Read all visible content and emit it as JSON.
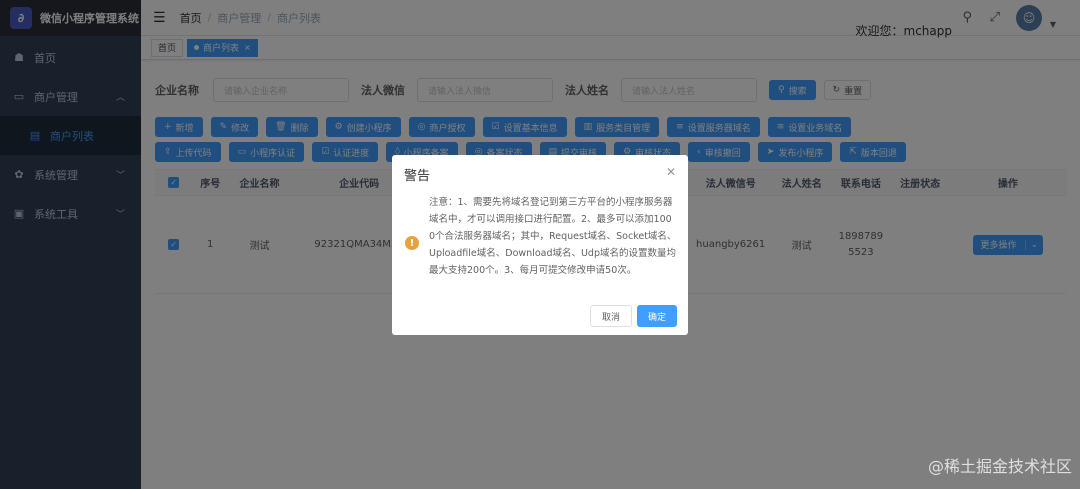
{
  "app": {
    "title": "微信小程序管理系统",
    "logo_glyph": "∂"
  },
  "sidebar": {
    "items": [
      {
        "label": "首页",
        "icon": "dashboard-icon"
      },
      {
        "label": "商户管理",
        "icon": "merchant-icon",
        "expanded": true
      },
      {
        "label": "商户列表",
        "icon": "list-icon",
        "active": true
      },
      {
        "label": "系统管理",
        "icon": "gear-icon"
      },
      {
        "label": "系统工具",
        "icon": "toolbox-icon"
      }
    ]
  },
  "navbar": {
    "breadcrumb": [
      "首页",
      "商户管理",
      "商户列表"
    ],
    "welcome": "欢迎您：mchapp"
  },
  "tags": [
    {
      "label": "首页",
      "active": false
    },
    {
      "label": "商户列表",
      "active": true
    }
  ],
  "search": {
    "fields": [
      {
        "label": "企业名称",
        "placeholder": "请输入企业名称"
      },
      {
        "label": "法人微信",
        "placeholder": "请输入法人微信"
      },
      {
        "label": "法人姓名",
        "placeholder": "请输入法人姓名"
      }
    ],
    "search_label": "搜索",
    "reset_label": "重置"
  },
  "toolbar_row1": [
    "新增",
    "修改",
    "删除",
    "创建小程序",
    "商户授权",
    "设置基本信息",
    "服务类目管理",
    "设置服务器域名",
    "设置业务域名"
  ],
  "toolbar_row2": [
    "上传代码",
    "小程序认证",
    "认证进度",
    "小程序备案",
    "备案状态",
    "提交审核",
    "审核状态",
    "审核撤回",
    "发布小程序",
    "版本回退"
  ],
  "table": {
    "headers": [
      "",
      "序号",
      "企业名称",
      "企业代码",
      "",
      "法人微信号",
      "法人姓名",
      "联系电话",
      "注册状态",
      "操作"
    ],
    "rows": [
      {
        "index": "1",
        "company": "测试",
        "code": "92321QMA34M50",
        "wechat": "huangby6261",
        "name": "测试",
        "phone": "18987895523",
        "status": "",
        "action": "更多操作"
      }
    ]
  },
  "dialog": {
    "title": "警告",
    "message": "注意：1、需要先将域名登记到第三方平台的小程序服务器域名中，才可以调用接口进行配置。2、最多可以添加1000个合法服务器域名；其中，Request域名、Socket域名、Uploadfile域名、Download域名、Udp域名的设置数量均最大支持200个。3、每月可提交修改申请50次。",
    "cancel_label": "取消",
    "confirm_label": "确定"
  },
  "watermark": "@稀土掘金技术社区",
  "colors": {
    "primary": "#409eff",
    "sidebar": "#304156",
    "warning": "#e6a23c"
  }
}
